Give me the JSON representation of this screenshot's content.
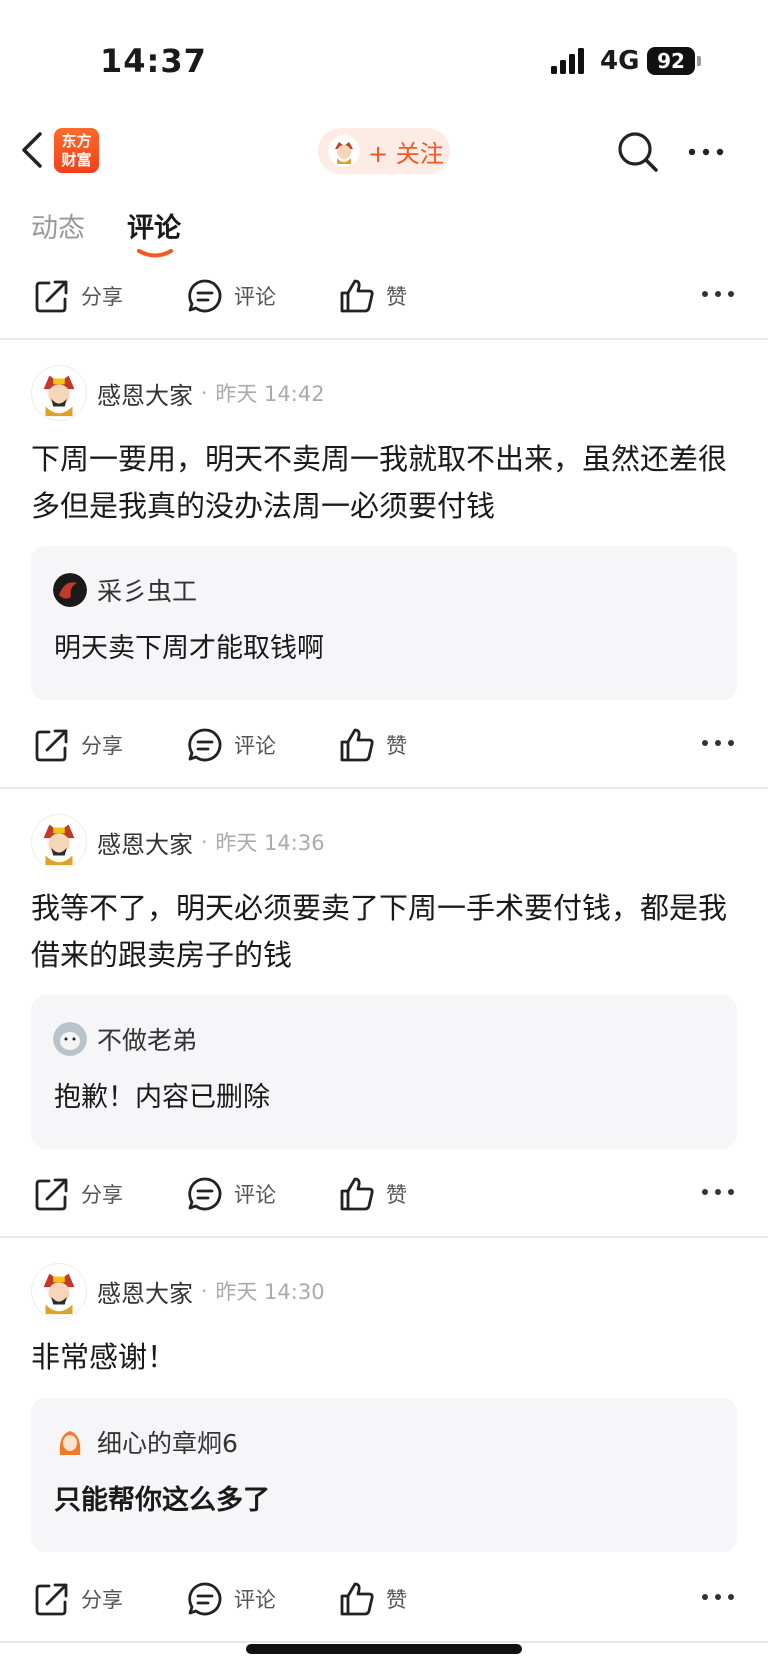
{
  "status_bar": {
    "time": "14:37",
    "network": "4G",
    "battery": "92"
  },
  "nav": {
    "logo_line1": "东方",
    "logo_line2": "财富",
    "follow_label": "+ 关注"
  },
  "tabs": [
    {
      "label": "动态"
    },
    {
      "label": "评论"
    }
  ],
  "actions": {
    "share": "分享",
    "comment": "评论",
    "like": "赞"
  },
  "posts": [
    {
      "author": "感恩大家",
      "time": "昨天 14:42",
      "body": "下周一要用，明天不卖周一我就取不出来，虽然还差很多但是我真的没办法周一必须要付钱",
      "quote": {
        "author": "采彡虫工",
        "text": "明天卖下周才能取钱啊"
      }
    },
    {
      "author": "感恩大家",
      "time": "昨天 14:36",
      "body": "我等不了，明天必须要卖了下周一手术要付钱，都是我借来的跟卖房子的钱",
      "quote": {
        "author": "不做老弟",
        "text": "抱歉！内容已删除"
      }
    },
    {
      "author": "感恩大家",
      "time": "昨天 14:30",
      "body": "非常感谢！",
      "quote": {
        "author": "细心的章炯6",
        "text": "只能帮你这么多了"
      }
    }
  ],
  "colors": {
    "accent": "#f25a22",
    "muted": "#999999",
    "quote_bg": "#f6f6f8"
  }
}
